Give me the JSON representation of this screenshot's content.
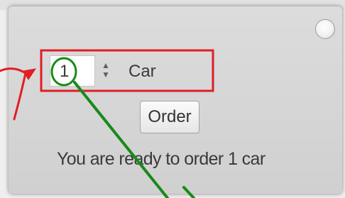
{
  "spinner": {
    "value": "1",
    "arrows": "▲▼",
    "unit": "Car"
  },
  "order_button": {
    "label": "Order"
  },
  "status": {
    "text": "You are ready to order 1 car"
  },
  "annotation_colors": {
    "red": "#e01e24",
    "green": "#178a1a"
  }
}
